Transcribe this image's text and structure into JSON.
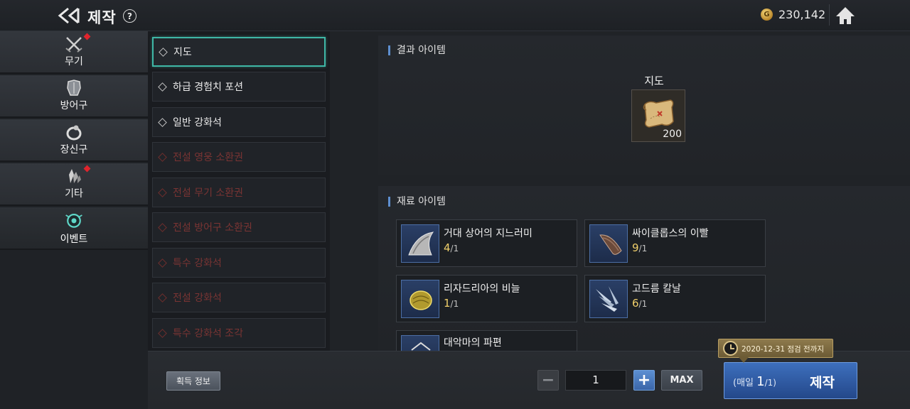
{
  "header": {
    "title": "제작",
    "help_icon": "question-circle-icon",
    "gold_amount": "230,142",
    "gold_symbol": "G"
  },
  "categories": [
    {
      "label": "무기",
      "icon": "crossed-swords-icon",
      "badge": true
    },
    {
      "label": "방어구",
      "icon": "armor-icon",
      "badge": false
    },
    {
      "label": "장신구",
      "icon": "ring-icon",
      "badge": false
    },
    {
      "label": "기타",
      "icon": "crystal-icon",
      "badge": true
    },
    {
      "label": "이벤트",
      "icon": "event-emblem-icon",
      "badge": false,
      "active": true
    }
  ],
  "recipes": [
    {
      "label": "지도",
      "state": "selected"
    },
    {
      "label": "하급 경험치 포션",
      "state": "available"
    },
    {
      "label": "일반 강화석",
      "state": "available"
    },
    {
      "label": "전설 영웅 소환권",
      "state": "disabled"
    },
    {
      "label": "전설 무기 소환권",
      "state": "disabled"
    },
    {
      "label": "전설 방어구 소환권",
      "state": "disabled"
    },
    {
      "label": "특수 강화석",
      "state": "disabled"
    },
    {
      "label": "전설 강화석",
      "state": "disabled"
    },
    {
      "label": "특수 강화석 조각",
      "state": "disabled"
    }
  ],
  "result": {
    "section_title": "결과 아이템",
    "name": "지도",
    "count": "200",
    "icon": "map-scroll-icon"
  },
  "materials": {
    "section_title": "재료 아이템",
    "items": [
      {
        "name": "거대 상어의 지느러미",
        "have": "4",
        "need": "/1",
        "icon": "shark-fin-icon"
      },
      {
        "name": "싸이클롭스의 이빨",
        "have": "9",
        "need": "/1",
        "icon": "tooth-icon"
      },
      {
        "name": "리자드리아의 비늘",
        "have": "1",
        "need": "/1",
        "icon": "scale-icon"
      },
      {
        "name": "고드름 칼날",
        "have": "6",
        "need": "/1",
        "icon": "icicle-blade-icon"
      },
      {
        "name": "대악마의 파편",
        "have": "",
        "need": "",
        "icon": "shard-icon"
      }
    ]
  },
  "footer": {
    "acquire_info_label": "획득 정보",
    "minus_label": "−",
    "quantity": "1",
    "plus_label": "+",
    "max_label": "MAX",
    "daily_prefix": "(매일",
    "daily_count": "1",
    "daily_suffix": "/1)",
    "craft_label": "제작",
    "tooltip": "2020-12-31 점검 전까지"
  },
  "colors": {
    "selected_border": "#3fb7a6",
    "disabled_text": "#7a3433",
    "primary_button": "#3d6fbd",
    "badge_red": "#e0242c",
    "quantity_gold": "#f0cf6a"
  }
}
